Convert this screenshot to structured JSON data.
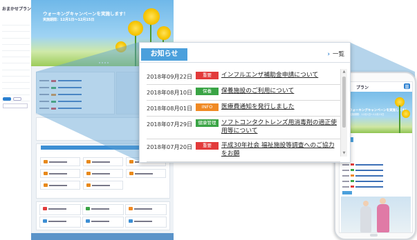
{
  "desktop": {
    "logo": "おまかせプラン",
    "hero_title": "ウォーキングキャンペーンを実施します！",
    "hero_period": "実施期間：12月1日～12月15日"
  },
  "phone": {
    "logo": "プラン",
    "hero_title": "ウォーキングキャンペーンを実施します！",
    "hero_period": "実施期間：12月1日～12月15日"
  },
  "notice": {
    "title": "お知らせ",
    "more_label": "一覧",
    "items": [
      {
        "date": "2018年09月22日",
        "badge": "重要",
        "badge_color": "#e23b3b",
        "title": "インフルエンザ補助金申請について"
      },
      {
        "date": "2018年08月10日",
        "badge": "保養",
        "badge_color": "#3aa445",
        "title": "保養施設のご利用について"
      },
      {
        "date": "2018年08月01日",
        "badge": "INFO",
        "badge_color": "#f08a24",
        "title": "医療費通知を発行しました"
      },
      {
        "date": "2018年07月29日",
        "badge": "健康管理",
        "badge_color": "#3aa445",
        "title": "ソフトコンタクトレンズ用消毒剤の適正使用等について"
      },
      {
        "date": "2018年07月20日",
        "badge": "重要",
        "badge_color": "#e23b3b",
        "title": "平成30年社会 福祉施設等調査へのご協力をお願"
      }
    ]
  },
  "colors": {
    "accent": "#4ba0dc",
    "link": "#2a7fd0",
    "badge_important": "#e23b3b",
    "badge_green": "#3aa445",
    "badge_info": "#f08a24"
  },
  "icons": [
    "chevron-right-icon",
    "scroll-up-icon",
    "scroll-down-icon",
    "hamburger-menu-icon"
  ]
}
